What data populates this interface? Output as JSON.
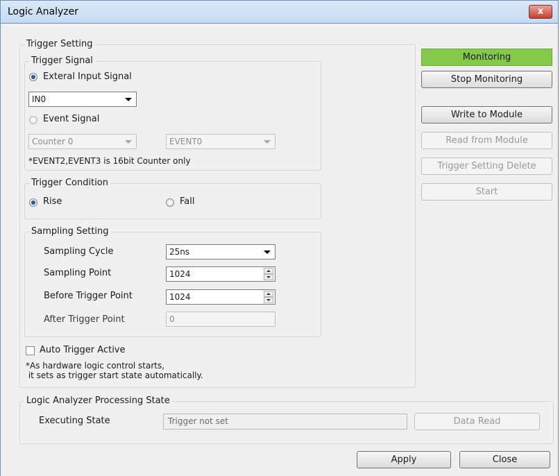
{
  "window": {
    "title": "Logic Analyzer",
    "close_glyph": "x"
  },
  "trigger_setting": {
    "group_label": "Trigger Setting",
    "trigger_signal": {
      "group_label": "Trigger Signal",
      "external_input_label": "Exteral Input Signal",
      "external_input_selected": "IN0",
      "event_signal_label": "Event Signal",
      "counter_selected": "Counter 0",
      "event_selected": "EVENT0",
      "note": "*EVENT2,EVENT3 is 16bit Counter only"
    },
    "trigger_condition": {
      "group_label": "Trigger Condition",
      "rise_label": "Rise",
      "fall_label": "Fall"
    },
    "sampling_setting": {
      "group_label": "Sampling Setting",
      "cycle_label": "Sampling Cycle",
      "cycle_value": "25ns",
      "point_label": "Sampling Point",
      "point_value": "1024",
      "before_label": "Before Trigger Point",
      "before_value": "1024",
      "after_label": "After Trigger Point",
      "after_value": "0"
    },
    "auto_trigger_label": "Auto Trigger Active",
    "auto_trigger_note_line1": "*As hardware logic control starts,",
    "auto_trigger_note_line2": " it sets as trigger start state automatically."
  },
  "side_panel": {
    "monitoring_status": "Monitoring",
    "stop_monitoring": "Stop Monitoring",
    "write_to_module": "Write to Module",
    "read_from_module": "Read from Module",
    "trigger_setting_delete": "Trigger Setting Delete",
    "start": "Start"
  },
  "processing_state": {
    "group_label": "Logic Analyzer Processing State",
    "executing_label": "Executing State",
    "executing_value": "Trigger not set",
    "data_read": "Data Read"
  },
  "footer": {
    "apply": "Apply",
    "close": "Close"
  },
  "colors": {
    "monitoring_green": "#84c94a",
    "titlebar": "#c5daf2"
  }
}
